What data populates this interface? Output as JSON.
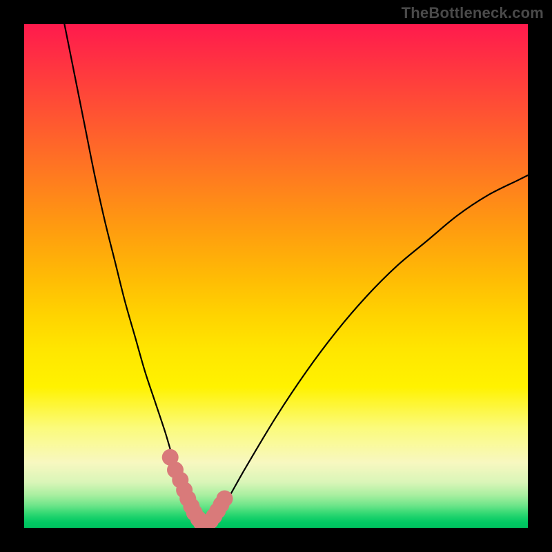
{
  "watermark": "TheBottleneck.com",
  "chart_data": {
    "type": "line",
    "title": "",
    "xlabel": "",
    "ylabel": "",
    "xlim": [
      0,
      100
    ],
    "ylim": [
      0,
      100
    ],
    "grid": false,
    "series": [
      {
        "name": "bottleneck-curve",
        "x": [
          8,
          10,
          12,
          14,
          16,
          18,
          20,
          22,
          24,
          26,
          28,
          29.5,
          31,
          32.5,
          34,
          35,
          36,
          37,
          38,
          40,
          44,
          50,
          56,
          62,
          68,
          74,
          80,
          86,
          92,
          98,
          100
        ],
        "values": [
          100,
          90,
          80,
          70,
          61,
          53,
          45,
          38,
          31,
          25,
          19,
          14,
          10,
          6,
          3,
          1.5,
          0.7,
          1.2,
          2.5,
          5,
          12,
          22,
          31,
          39,
          46,
          52,
          57,
          62,
          66,
          69,
          70
        ]
      }
    ],
    "markers": [
      {
        "name": "left-blob-1",
        "x": 29.0,
        "y": 14.0
      },
      {
        "name": "left-blob-2",
        "x": 30.0,
        "y": 11.5
      },
      {
        "name": "left-blob-3",
        "x": 31.0,
        "y": 9.5
      },
      {
        "name": "left-blob-4",
        "x": 31.8,
        "y": 7.5
      },
      {
        "name": "left-blob-5",
        "x": 32.5,
        "y": 5.8
      },
      {
        "name": "left-blob-6",
        "x": 33.2,
        "y": 4.3
      },
      {
        "name": "left-blob-7",
        "x": 33.8,
        "y": 3.0
      },
      {
        "name": "bottom-1",
        "x": 34.6,
        "y": 1.8
      },
      {
        "name": "bottom-2",
        "x": 35.2,
        "y": 1.0
      },
      {
        "name": "bottom-3",
        "x": 36.0,
        "y": 0.8
      },
      {
        "name": "right-blob-1",
        "x": 37.0,
        "y": 1.4
      },
      {
        "name": "right-blob-2",
        "x": 37.7,
        "y": 2.3
      },
      {
        "name": "right-blob-3",
        "x": 38.4,
        "y": 3.4
      },
      {
        "name": "right-blob-4",
        "x": 39.1,
        "y": 4.6
      },
      {
        "name": "right-blob-5",
        "x": 39.8,
        "y": 5.8
      }
    ],
    "background_gradient": {
      "top": "#ff1a4d",
      "mid": "#ffe700",
      "bottom": "#00c25f"
    }
  }
}
